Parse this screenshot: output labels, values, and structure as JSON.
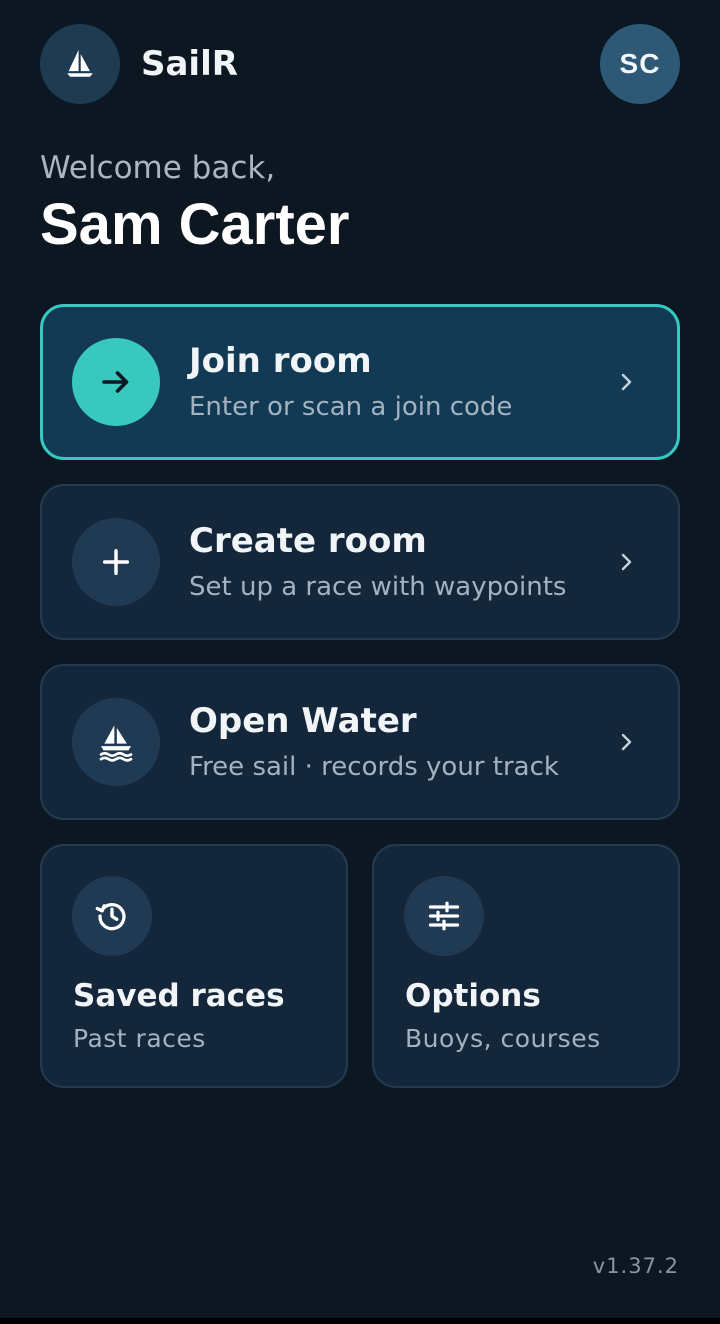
{
  "header": {
    "app_title": "SailR",
    "avatar_initials": "SC",
    "logo_icon": "sailboat-icon"
  },
  "greeting": {
    "welcome": "Welcome back,",
    "name": "Sam Carter"
  },
  "actions": [
    {
      "title": "Join room",
      "subtitle": "Enter or scan a join code",
      "icon": "arrow-right-icon"
    },
    {
      "title": "Create room",
      "subtitle": "Set up a race with waypoints",
      "icon": "plus-icon"
    },
    {
      "title": "Open Water",
      "subtitle": "Free sail · records your track",
      "icon": "sailboat-waves-icon"
    }
  ],
  "tiles": [
    {
      "title": "Saved races",
      "subtitle": "Past races",
      "icon": "history-icon"
    },
    {
      "title": "Options",
      "subtitle": "Buoys, courses",
      "icon": "sliders-icon"
    }
  ],
  "footer": {
    "version": "v1.37.2"
  },
  "colors": {
    "background": "#0c1722",
    "card": "#13263a",
    "primary_card": "#123a55",
    "accent": "#38c8bd"
  }
}
